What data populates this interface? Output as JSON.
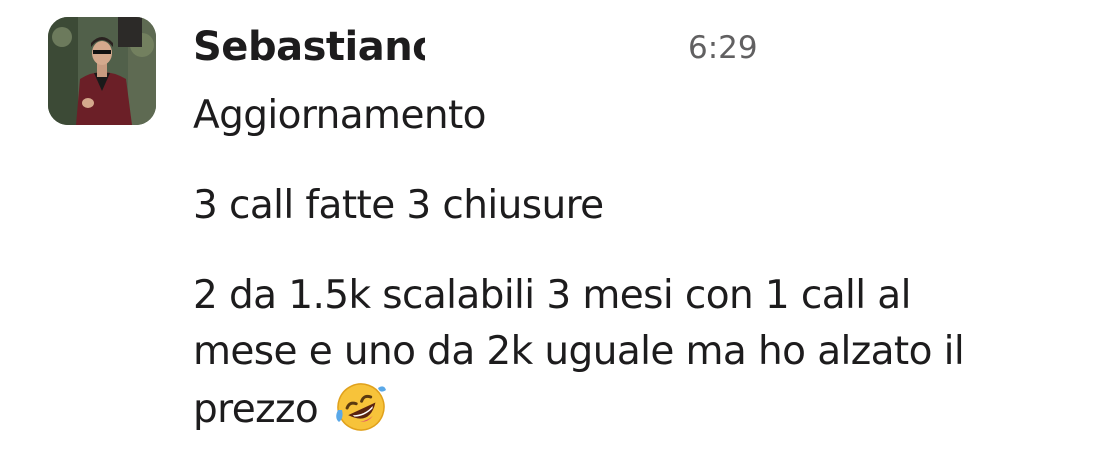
{
  "message": {
    "sender": "Sebastiano",
    "time": "6:29",
    "line1": "Aggiornamento",
    "line2": "3 call fatte 3 chiusure",
    "paragraph3": "2 da 1.5k scalabili 3 mesi con 1 call al mese e uno da 2k uguale ma ho alzato il prezzo",
    "paragraph3_lines": [
      "2 da 1.5k scalabili 3 mesi con 1 call al",
      "mese e uno da 2k uguale ma ho alzato il",
      "prezzo"
    ],
    "emoji": "rolling-on-the-floor-laughing-icon"
  },
  "colors": {
    "text": "#1d1c1d",
    "timestamp": "#616061",
    "background": "#ffffff",
    "emoji_face": "#f7c33a",
    "tear": "#5aa8e8"
  }
}
